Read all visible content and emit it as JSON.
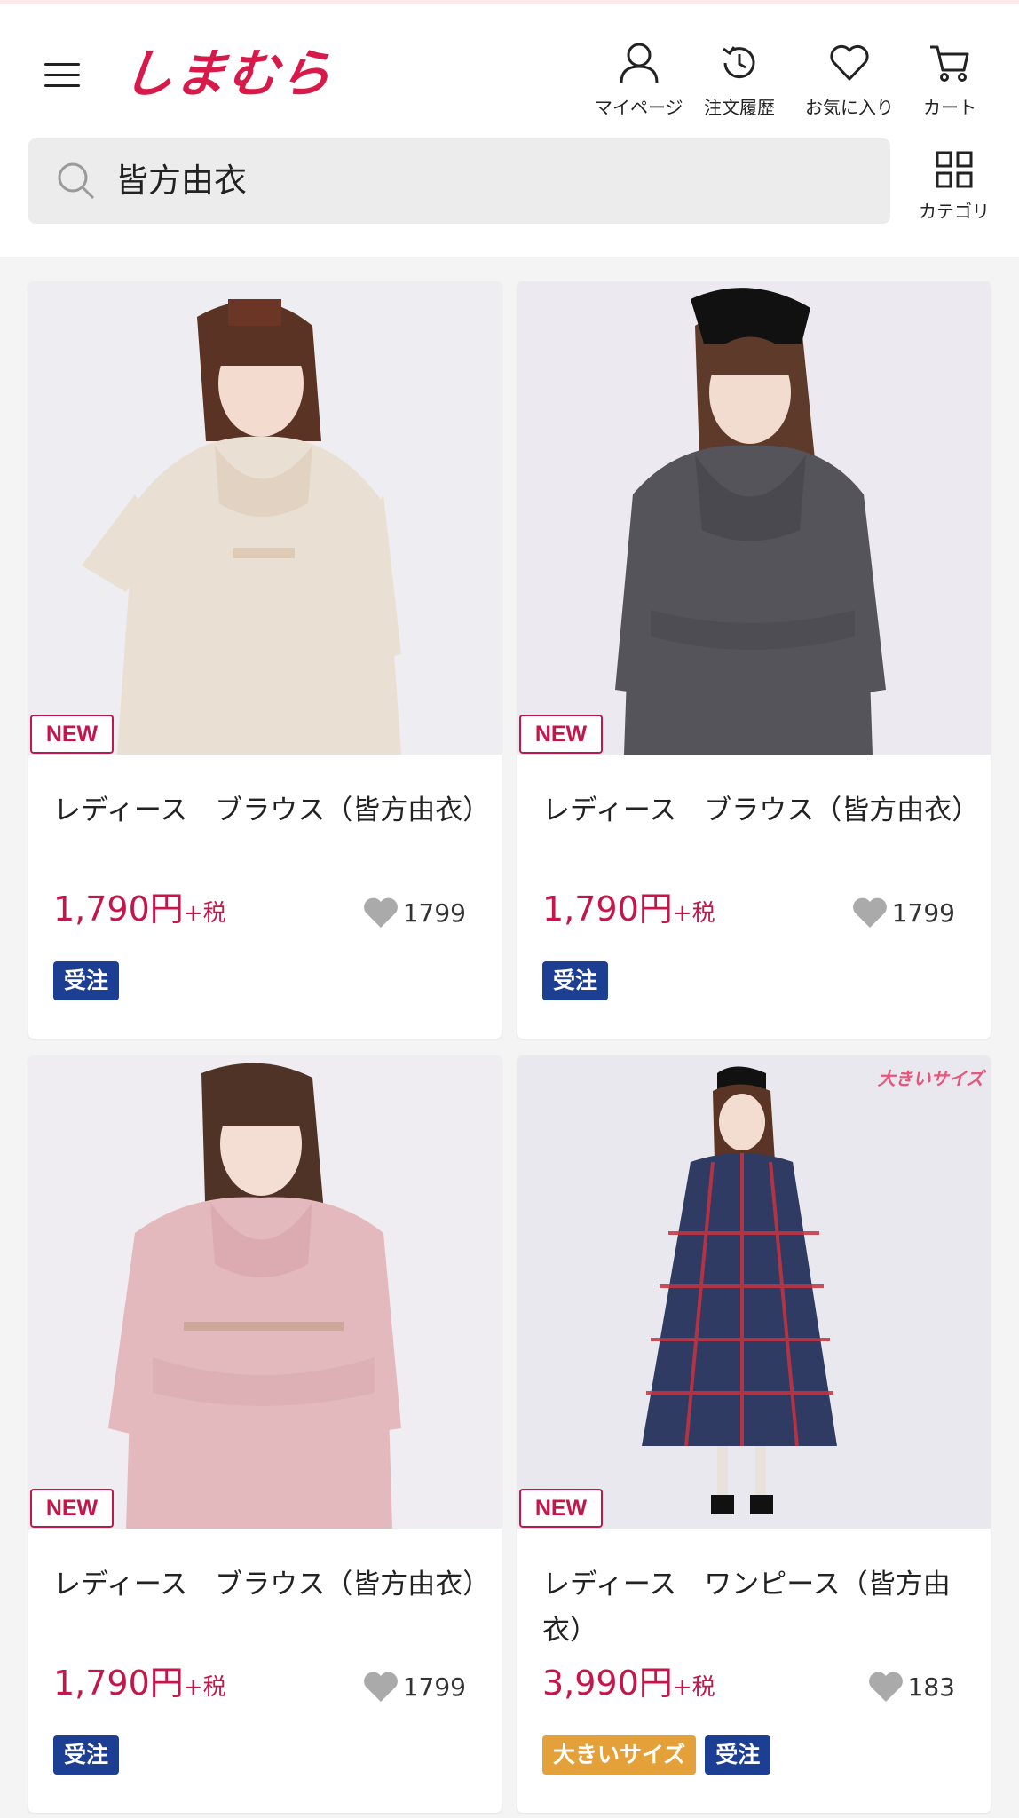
{
  "header": {
    "logo": "しまむら",
    "nav": [
      {
        "label": "マイページ",
        "icon": "user-icon"
      },
      {
        "label": "注文履歴",
        "icon": "history-icon"
      },
      {
        "label": "お気に入り",
        "icon": "heart-icon"
      },
      {
        "label": "カート",
        "icon": "cart-icon"
      }
    ],
    "search": {
      "value": "皆方由衣"
    },
    "category_label": "カテゴリ"
  },
  "colors": {
    "brand": "#d81a4a",
    "price": "#c4164a",
    "order_tag": "#1c3f94",
    "big_size_tag": "#e4a13a"
  },
  "products": [
    {
      "badge": "NEW",
      "title": "レディース　ブラウス（皆方由衣）",
      "price": "1,790円",
      "tax": "+税",
      "likes": "1799",
      "tags": [
        "受注"
      ]
    },
    {
      "badge": "NEW",
      "title": "レディース　ブラウス（皆方由衣）",
      "price": "1,790円",
      "tax": "+税",
      "likes": "1799",
      "tags": [
        "受注"
      ]
    },
    {
      "badge": "NEW",
      "title": "レディース　ブラウス（皆方由衣）",
      "price": "1,790円",
      "tax": "+税",
      "likes": "1799",
      "tags": [
        "受注"
      ]
    },
    {
      "badge": "NEW",
      "size_flag": "大きいサイズ",
      "title": "レディース　ワンピース（皆方由衣）",
      "price": "3,990円",
      "tax": "+税",
      "likes": "183",
      "tags": [
        "大きいサイズ",
        "受注"
      ]
    }
  ]
}
